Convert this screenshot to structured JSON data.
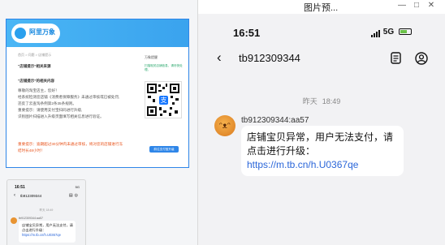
{
  "viewer": {
    "title": "图片预...",
    "controls": [
      "—",
      "□",
      "✕"
    ]
  },
  "thumbnail1": {
    "logo": "阿里万象",
    "breadcrumb": "首页 > 问题 > 店铺提示",
    "section1_title": "“店铺提示”相关来源",
    "section2_title": "“店铺提示”的相关内容",
    "paragraph_lines": [
      "尊敬的淘宝店主，您好！",
      "经系统检测您店铺《消费者保障服务》未通过审核或已被处罚,",
      "违反了云查淘条例第2条35条规则。",
      "重要提示：请使用支付宝扫码进行升级,",
      "识别图片扫描进入升级页面填写相关信息进行验证。"
    ],
    "warning_lines": [
      "重要提示：逾期超过30分钟内未通过审核，将对您的店铺进行冻",
      "结时长48小时！"
    ],
    "side_title": "万象提醒",
    "side_note": "扫描相关店铺信息，请尽快处理。",
    "qr_icon": "alipay-icon",
    "button_label": "前往支付宝升级"
  },
  "thumbnail2": {
    "time": "16:51",
    "status": "5G",
    "title": "tb912309344",
    "timestamp": "昨天 18:49",
    "sender": "tb912309344:aa57",
    "message": "店铺宝贝异常，用户无法支付，请点击进行升级：",
    "link": "https://m.tb.cn/h.U0367qe"
  },
  "phone": {
    "time": "16:51",
    "network": "5G",
    "chat_title": "tb912309344",
    "timestamp_day": "昨天",
    "timestamp_time": "18:49",
    "sender": "tb912309344:aa57",
    "message": "店铺宝贝异常，用户无法支付，请点击进行升级：",
    "link": "https://m.tb.cn/h.U0367qe"
  },
  "colors": {
    "accent": "#2f86e8",
    "link": "#2a66d9",
    "warning": "#e8541c",
    "battery": "#6cc24a"
  }
}
